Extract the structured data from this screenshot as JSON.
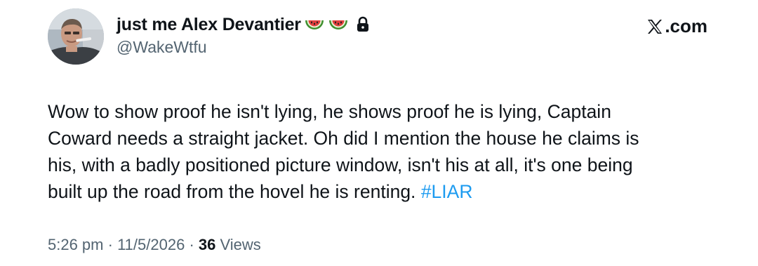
{
  "author": {
    "display_name": "just me Alex Devantier",
    "handle": "@WakeWtfu",
    "badges": [
      "watermelon-emoji",
      "watermelon-emoji",
      "lock-icon"
    ],
    "avatar": "profile-photo"
  },
  "site": {
    "label": ".com",
    "logo": "x-logo-icon"
  },
  "tweet": {
    "lines": [
      "Wow to show proof he isn't lying, he shows proof he is lying, Captain",
      "Coward needs a straight jacket. Oh did I mention the house he claims is",
      "his, with a badly positioned picture window, isn't his at all, it's one being",
      "built up the road from the hovel he is renting."
    ],
    "hashtag": "#LIAR"
  },
  "meta": {
    "time": "5:26 pm",
    "separator": "·",
    "date": "11/5/2026",
    "view_count": "36",
    "views_label": "Views"
  },
  "colors": {
    "text": "#0f1419",
    "secondary": "#536471",
    "link": "#1d9bf0"
  }
}
